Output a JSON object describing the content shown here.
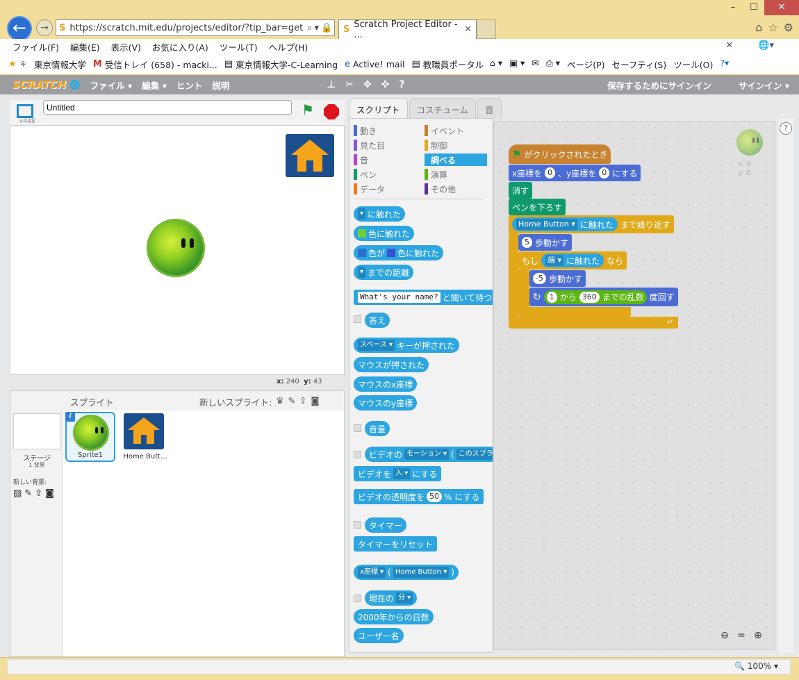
{
  "browser": {
    "url": "https://scratch.mit.edu/projects/editor/?tip_bar=get",
    "tab_title": "Scratch Project Editor - ...",
    "menu": [
      "ファイル(F)",
      "編集(E)",
      "表示(V)",
      "お気に入り(A)",
      "ツール(T)",
      "ヘルプ(H)"
    ],
    "favorites": [
      "東京情報大学",
      "受信トレイ (658) - macki...",
      "東京情報大学-C-Learning",
      "Active! mail",
      "教職員ポータル"
    ],
    "commands": [
      "ページ(P)",
      "セーフティ(S)",
      "ツール(O)"
    ],
    "zoom": "100%"
  },
  "scratch": {
    "logo": "SCRATCH",
    "menu": [
      "ファイル",
      "編集",
      "ヒント",
      "説明"
    ],
    "save_signin": "保存するためにサインイン",
    "signin": "サインイン",
    "project_title": "Untitled",
    "version": "v448",
    "stage_xy": {
      "x_label": "x:",
      "x": "240",
      "y_label": "y:",
      "y": "43"
    },
    "sprite_pane": {
      "label": "スプライト",
      "new_sprite": "新しいスプライト:",
      "stage_label": "ステージ",
      "bg_count": "1 背景",
      "new_bg": "新しい背景:",
      "sprites": [
        "Sprite1",
        "Home Butt..."
      ]
    },
    "tabs": [
      "スクリプト",
      "コスチューム",
      "音"
    ],
    "categories": [
      {
        "label": "動き",
        "color": "#4a6cd4"
      },
      {
        "label": "イベント",
        "color": "#c88330"
      },
      {
        "label": "見た目",
        "color": "#8a55d7"
      },
      {
        "label": "制御",
        "color": "#e1a91a"
      },
      {
        "label": "音",
        "color": "#bb42c3"
      },
      {
        "label": "調べる",
        "color": "#2ca5e0"
      },
      {
        "label": "ペン",
        "color": "#0e9a6c"
      },
      {
        "label": "演算",
        "color": "#5cb712"
      },
      {
        "label": "データ",
        "color": "#ee7d16"
      },
      {
        "label": "その他",
        "color": "#632d99"
      }
    ],
    "palette": {
      "touching": "に触れた",
      "touching_color": "色に触れた",
      "color_is": "色が",
      "color_touching": "色に触れた",
      "distance": "までの距離",
      "ask_default": "What's your name?",
      "ask": "と聞いて待つ",
      "answer": "答え",
      "key": "スペース",
      "key_pressed": "キーが押された",
      "mouse_down": "マウスが押された",
      "mouse_x": "マウスのx座標",
      "mouse_y": "マウスのy座標",
      "loudness": "音量",
      "video": "ビデオの",
      "video_motion": "モーション",
      "video_target": "このスプラ",
      "video_set": "ビデオを",
      "video_on": "入",
      "video_set_end": "にする",
      "video_trans": "ビデオの透明度を",
      "video_trans_val": "50",
      "video_trans_end": "% にする",
      "timer": "タイマー",
      "reset_timer": "タイマーをリセット",
      "of_attr": "x座標",
      "of_sprite": "Home Button",
      "current": "現在の",
      "current_unit": "分",
      "days_since": "2000年からの日数",
      "username": "ユーザー名"
    },
    "script": {
      "when_flag": "がクリックされたとき",
      "goto_x": "x座標を",
      "goto_x_val": "0",
      "goto_y": "、y座標を",
      "goto_y_val": "0",
      "goto_end": "にする",
      "clear": "消す",
      "pen_down": "ペンを下ろす",
      "repeat_until_obj": "Home Button",
      "repeat_until_touch": "に触れた",
      "repeat_until": "まで繰り返す",
      "move_val": "5",
      "move": "歩動かす",
      "if": "もし",
      "edge": "端",
      "then": "なら",
      "move_back_val": "-5",
      "move_back": "歩動かす",
      "rand_from": "1",
      "rand_from_lbl": "から",
      "rand_to": "360",
      "rand_to_lbl": "までの乱数",
      "turn": "度回す"
    },
    "mini_xy": {
      "x": "x: 0",
      "y": "y: 0"
    }
  }
}
